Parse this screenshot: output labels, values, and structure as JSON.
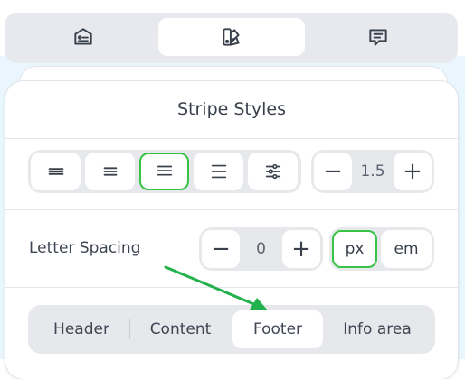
{
  "top_tabs": [
    {
      "icon": "tag-card-icon",
      "active": false
    },
    {
      "icon": "color-swatch-icon",
      "active": true
    },
    {
      "icon": "message-icon",
      "active": false
    }
  ],
  "panel": {
    "title": "Stripe Styles"
  },
  "alignment_buttons": [
    {
      "icon": "align-full-icon",
      "active": false
    },
    {
      "icon": "align-left-icon",
      "active": false
    },
    {
      "icon": "align-center-icon",
      "active": true
    },
    {
      "icon": "align-right-icon",
      "active": false
    },
    {
      "icon": "sliders-icon",
      "active": false
    }
  ],
  "line_height": {
    "decrement": "−",
    "value": "1.5",
    "increment": "+"
  },
  "letter_spacing": {
    "label": "Letter Spacing",
    "decrement": "−",
    "value": "0",
    "increment": "+",
    "units": [
      {
        "label": "px",
        "active": true
      },
      {
        "label": "em",
        "active": false
      }
    ]
  },
  "sections": [
    {
      "label": "Header",
      "active": false
    },
    {
      "label": "Content",
      "active": false
    },
    {
      "label": "Footer",
      "active": true
    },
    {
      "label": "Info area",
      "active": false
    }
  ],
  "colors": {
    "accent_green": "#37c346",
    "annotation_arrow": "#22b14c"
  }
}
